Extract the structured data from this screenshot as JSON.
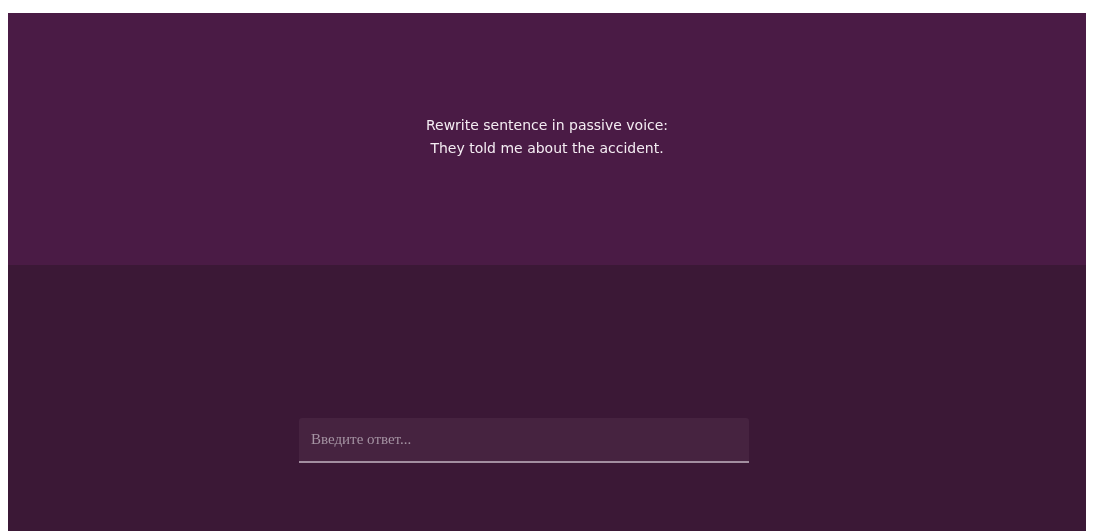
{
  "question": {
    "lines": [
      "Rewrite sentence in passive voice:",
      "They told me about the accident."
    ]
  },
  "answer": {
    "placeholder": "Введите ответ..."
  }
}
